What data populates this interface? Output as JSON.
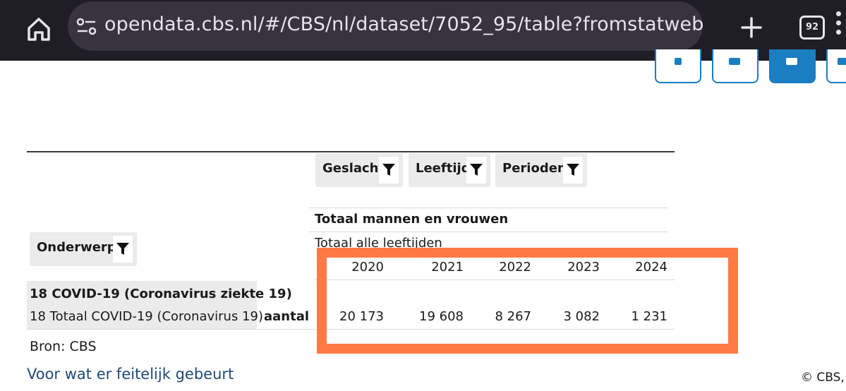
{
  "browser": {
    "url": "opendata.cbs.nl/#/CBS/nl/dataset/7052_95/table?fromstatweb",
    "tab_count": "92"
  },
  "filters": {
    "columns": [
      "Geslacht",
      "Leeftijd",
      "Perioden"
    ],
    "rows": "Onderwerp"
  },
  "table": {
    "gender": "Totaal mannen en vrouwen",
    "age": "Totaal alle leeftijden",
    "years": [
      "2020",
      "2021",
      "2022",
      "2023",
      "2024"
    ],
    "subject_title": "18 COVID-19 (Coronavirus ziekte 19)",
    "subject_sub": "18 Totaal COVID-19 (Coronavirus 19)",
    "unit": "aantal",
    "values": [
      "20 173",
      "19 608",
      "8 267",
      "3 082",
      "1 231"
    ]
  },
  "source": "Bron: CBS",
  "footer": {
    "link": "Voor wat er feitelijk gebeurt",
    "copyright": "© CBS,"
  },
  "colors": {
    "accent": "#1b7ec2",
    "annotation": "#ff7a45"
  }
}
